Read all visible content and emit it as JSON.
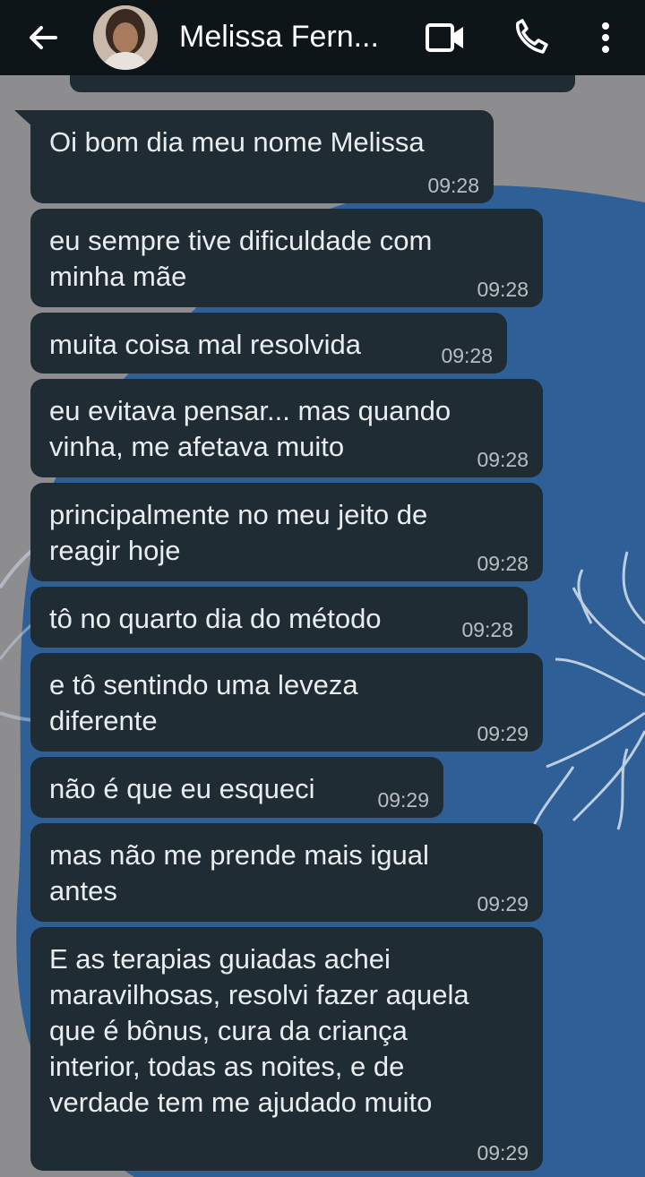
{
  "header": {
    "contact_name": "Melissa Fern...",
    "icons": [
      "back-arrow-icon",
      "avatar",
      "video-call-icon",
      "voice-call-icon",
      "more-vert-icon"
    ]
  },
  "colors": {
    "header_bg": "#0e1519",
    "bubble_bg": "#202c33",
    "bubble_text": "#e9edef",
    "timestamp_text": "#b8bec2",
    "wallpaper_blue": "#2f5f97",
    "wallpaper_gray": "#8d8d8f"
  },
  "messages": [
    {
      "text": "Oi bom dia meu nome Melissa",
      "time": "09:28"
    },
    {
      "text": "eu sempre tive dificuldade com\nminha mãe",
      "time": "09:28"
    },
    {
      "text": "muita coisa mal resolvida",
      "time": "09:28"
    },
    {
      "text": "eu evitava pensar... mas quando\nvinha, me afetava muito",
      "time": "09:28"
    },
    {
      "text": "principalmente no meu jeito de\nreagir hoje",
      "time": "09:28"
    },
    {
      "text": "tô no quarto dia do método",
      "time": "09:28"
    },
    {
      "text": "e tô sentindo uma leveza\ndiferente",
      "time": "09:29"
    },
    {
      "text": "não é que eu esqueci",
      "time": "09:29"
    },
    {
      "text": "mas não me prende mais igual\nantes",
      "time": "09:29"
    },
    {
      "text": "E as terapias guiadas achei\nmaravilhosas, resolvi fazer aquela\nque é bônus, cura da criança\ninterior, todas as noites, e de\nverdade tem me ajudado muito",
      "time": "09:29"
    }
  ]
}
